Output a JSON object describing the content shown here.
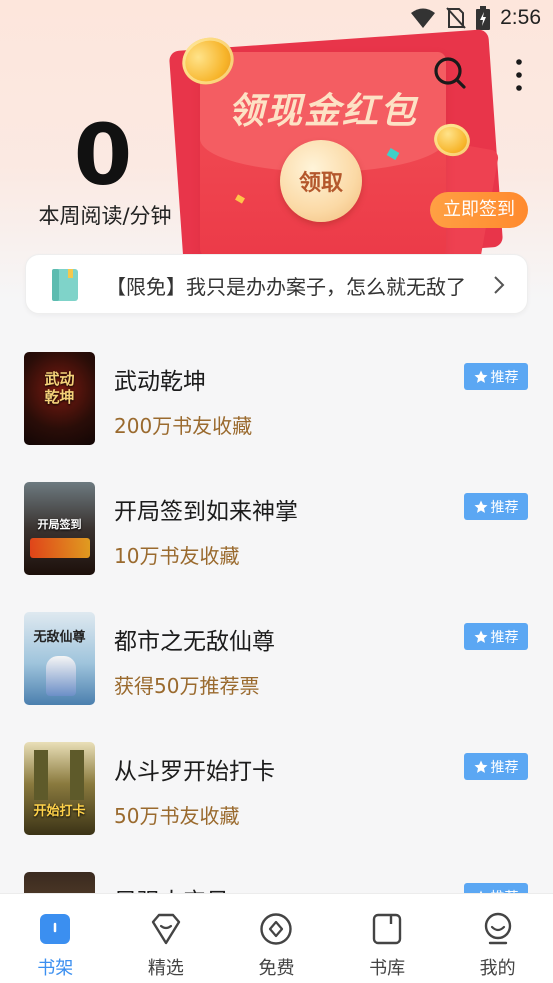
{
  "status_bar": {
    "time": "2:56"
  },
  "header": {
    "read_count": "0",
    "read_label": "本周阅读/分钟",
    "envelope_title": "领现金红包",
    "claim_label": "领取",
    "checkin_label": "立即签到"
  },
  "banner": {
    "text": "【限免】我只是办办案子，怎么就无敌了"
  },
  "books": [
    {
      "title": "武动乾坤",
      "meta": "200万书友收藏",
      "badge": "推荐",
      "cover_text": "武动乾坤"
    },
    {
      "title": "开局签到如来神掌",
      "meta": "10万书友收藏",
      "badge": "推荐",
      "cover_text": "开局签到"
    },
    {
      "title": "都市之无敌仙尊",
      "meta": "获得50万推荐票",
      "badge": "推荐",
      "cover_text": "无敌仙尊"
    },
    {
      "title": "从斗罗开始打卡",
      "meta": "50万书友收藏",
      "badge": "推荐",
      "cover_text": "开始打卡"
    },
    {
      "title": "早强大宝贝",
      "meta": "",
      "badge": "推荐",
      "cover_text": ""
    }
  ],
  "nav": [
    {
      "label": "书架",
      "icon": "bookshelf-icon",
      "active": true
    },
    {
      "label": "精选",
      "icon": "diamond-icon",
      "active": false
    },
    {
      "label": "免费",
      "icon": "free-icon",
      "active": false
    },
    {
      "label": "书库",
      "icon": "library-icon",
      "active": false
    },
    {
      "label": "我的",
      "icon": "profile-icon",
      "active": false
    }
  ],
  "colors": {
    "accent": "#3b8ff0",
    "badge": "#5ba7f3",
    "meta_text": "#9a6a2e",
    "envelope": "#ec3a48",
    "checkin": "#ff8a2e"
  }
}
